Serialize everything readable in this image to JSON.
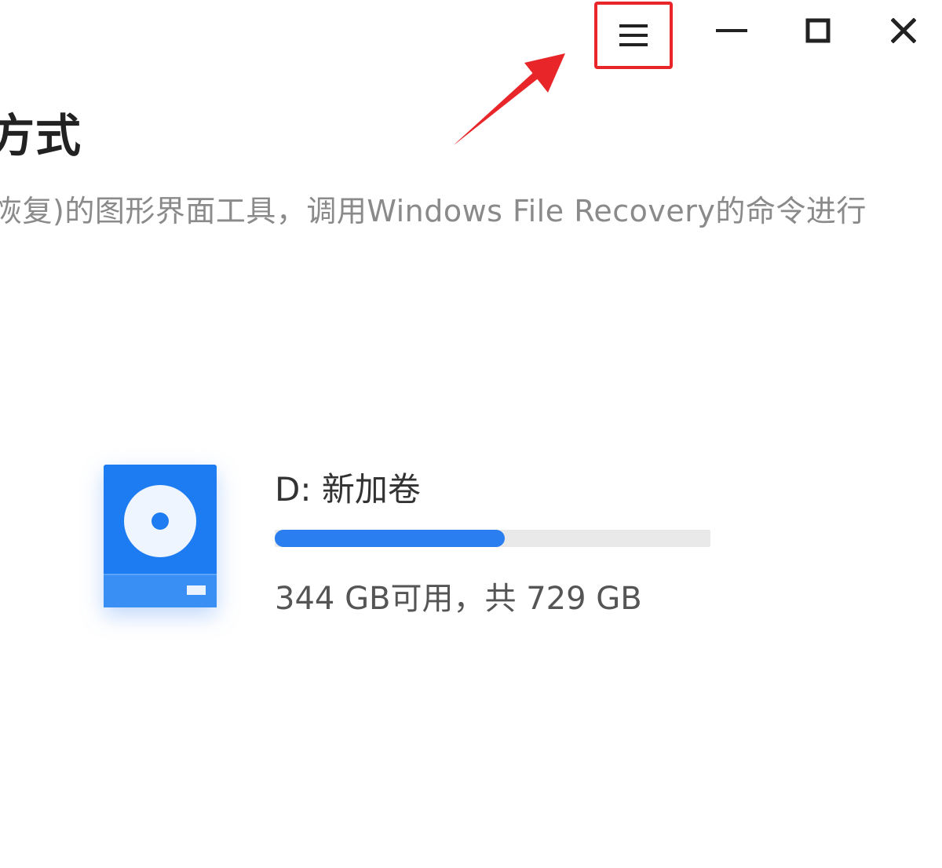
{
  "window_controls": {
    "menu_icon": "hamburger-menu-icon",
    "minimize_icon": "minimize-icon",
    "maximize_icon": "maximize-icon",
    "close_icon": "close-icon"
  },
  "header": {
    "title": "方式",
    "description": "恢复)的图形界面工具，调用Windows File Recovery的命令进行"
  },
  "drive": {
    "icon": "drive-disk-icon",
    "name": "D: 新加卷",
    "space_text": "344 GB可用，共 729 GB",
    "free_gb": 344,
    "total_gb": 729,
    "used_fraction": 0.528
  },
  "colors": {
    "accent": "#2b7ef0",
    "annotation": "#e8262a"
  }
}
